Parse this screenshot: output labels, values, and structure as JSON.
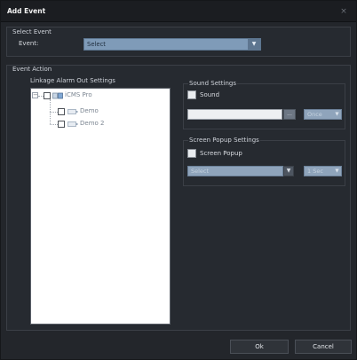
{
  "window": {
    "title": "Add Event",
    "close_glyph": "×"
  },
  "select_event": {
    "group_title": "Select Event",
    "event_label": "Event:",
    "event_value": "Select"
  },
  "event_action": {
    "group_title": "Event Action",
    "linkage": {
      "title": "Linkage Alarm Out Settings",
      "tree": {
        "root": {
          "label": "iCMS Pro",
          "expanded": true,
          "checked": false
        },
        "children": [
          {
            "label": "Demo",
            "checked": false
          },
          {
            "label": "Demo 2",
            "checked": false
          }
        ]
      }
    },
    "sound": {
      "title": "Sound Settings",
      "checkbox_label": "Sound",
      "checked": false,
      "file_value": "",
      "browse_label": "...",
      "repeat_value": "Once"
    },
    "popup": {
      "title": "Screen Popup Settings",
      "checkbox_label": "Screen Popup",
      "checked": false,
      "target_value": "Select",
      "duration_value": "1 Sec"
    }
  },
  "footer": {
    "ok_label": "Ok",
    "cancel_label": "Cancel"
  },
  "colors": {
    "dialog_background": "#23262b",
    "title_bar": "#1b1d21",
    "select_accent": "#7f9bb8",
    "tree_background": "#ffffff"
  },
  "icons": {
    "close": "close-icon",
    "dropdown": "chevron-down-icon",
    "device": "server-icon",
    "camera": "camera-icon"
  }
}
